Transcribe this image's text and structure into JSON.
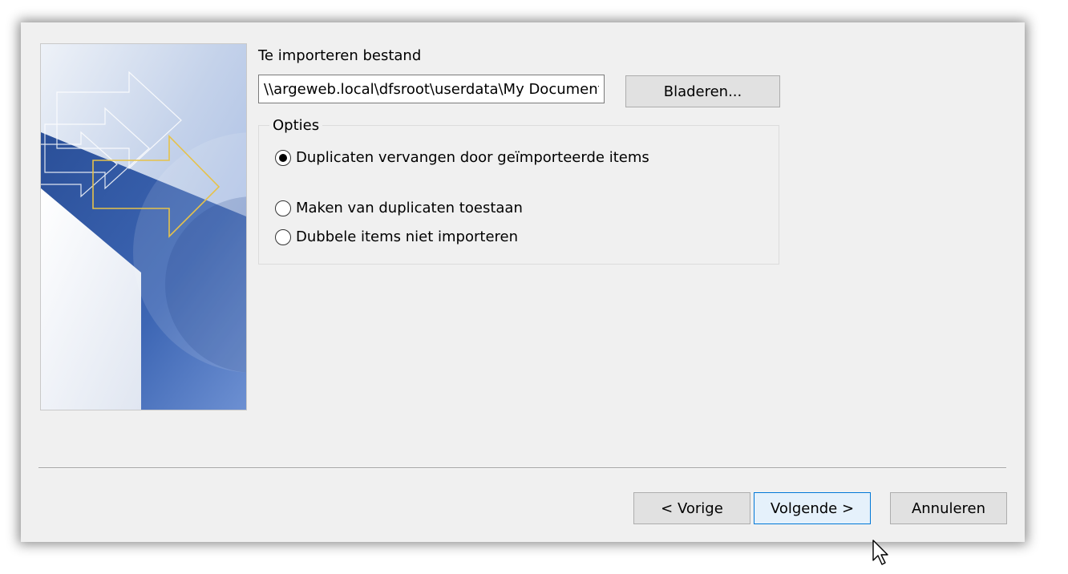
{
  "import_file": {
    "label": "Te importeren bestand",
    "path_value": "\\\\argeweb.local\\dfsroot\\userdata\\My Documents",
    "browse_label": "Bladeren..."
  },
  "options": {
    "title": "Opties",
    "radios": [
      {
        "label": "Duplicaten vervangen door geïmporteerde items",
        "checked": true
      },
      {
        "label": "Maken van duplicaten toestaan",
        "checked": false
      },
      {
        "label": "Dubbele items niet importeren",
        "checked": false
      }
    ]
  },
  "footer": {
    "back_label": "< Vorige",
    "next_label": "Volgende >",
    "cancel_label": "Annuleren"
  },
  "colors": {
    "dialog_bg": "#f0f0f0",
    "banner_blue": "#2f5ba8",
    "arrow_gold": "#e6c24a",
    "focus_border": "#0078d7"
  }
}
